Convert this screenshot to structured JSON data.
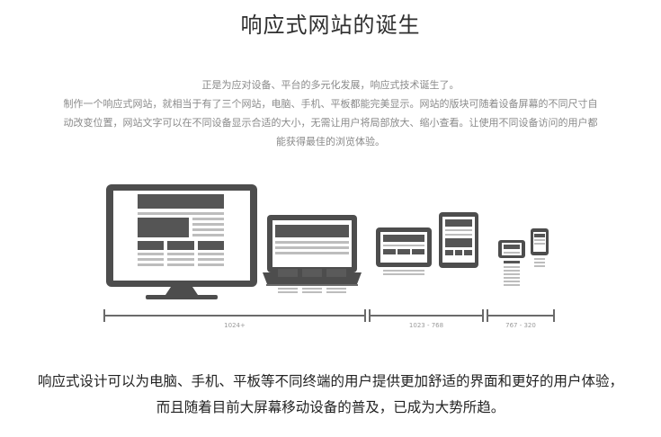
{
  "title": "响应式网站的诞生",
  "intro": {
    "line1": "正是为应对设备、平台的多元化发展，响应式技术诞生了。",
    "line2": "制作一个响应式网站，就相当于有了三个网站，电脑、手机、平板都能完美显示。网站的版块可随着设备屏幕的不同尺寸自",
    "line3": "动改变位置，网站文字可以在不同设备显示合适的大小，无需让用户将局部放大、缩小查看。让使用不同设备访问的用户都",
    "line4": "能获得最佳的浏览体验。"
  },
  "ranges": {
    "desktop": "1024+",
    "tablet": "1023 - 768",
    "mobile": "767 - 320"
  },
  "bottom": {
    "line1": "响应式设计可以为电脑、手机、平板等不同终端的用户提供更加舒适的界面和更好的用户体验，",
    "line2": "而且随着目前大屏幕移动设备的普及，已成为大势所趋。"
  },
  "colors": {
    "device": "#4d4d4d",
    "screen": "#ffffff",
    "block": "#555555",
    "line": "#bdbdbd"
  }
}
